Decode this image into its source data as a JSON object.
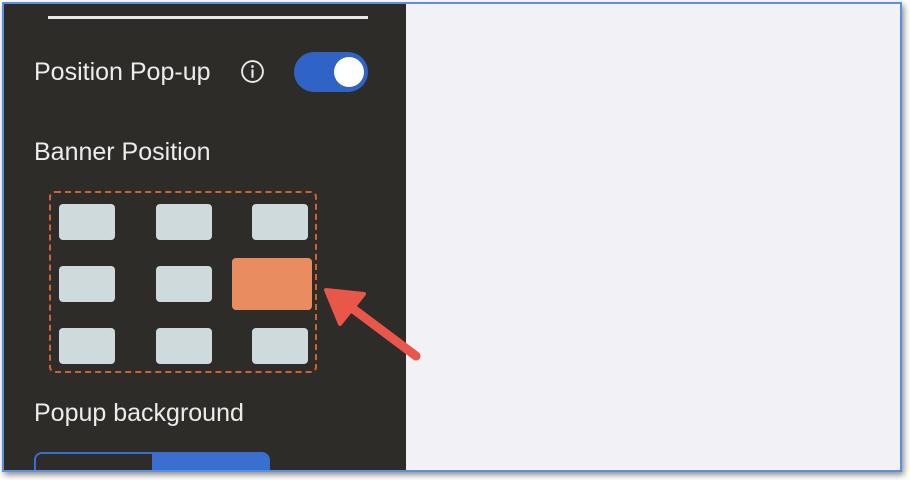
{
  "panel": {
    "position_popup": {
      "label": "Position Pop-up",
      "toggle_on": true,
      "icon": "info-icon"
    },
    "banner_position": {
      "label": "Banner Position",
      "rows": 3,
      "columns": 3,
      "selected": {
        "row": 2,
        "column": 3
      }
    },
    "popup_background": {
      "label": "Popup background"
    }
  },
  "colors": {
    "panel_bg": "#2d2c28",
    "toggle_on": "#2f63c6",
    "cell": "#cfdadc",
    "cell_selected": "#e98d60",
    "grid_border": "#d06230",
    "arrow": "#e9564a",
    "frame_border": "#5b8fe0"
  }
}
